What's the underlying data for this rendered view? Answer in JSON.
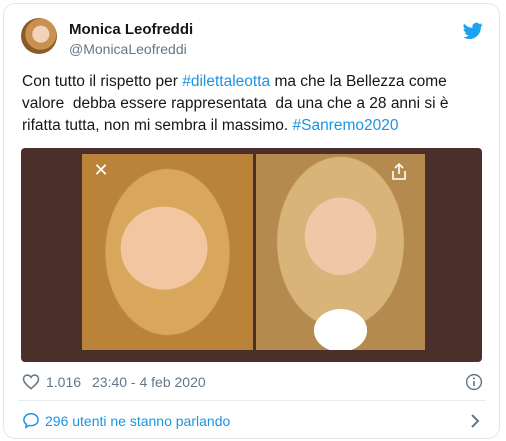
{
  "author": {
    "name": "Monica Leofreddi",
    "handle": "@MonicaLeofreddi"
  },
  "tweet": {
    "text_before": "Con tutto il rispetto per ",
    "mention_tag": "#dilettaleotta",
    "text_middle": " ma che la Bellezza come valore  debba essere rappresentata  da una che a 28 anni si è rifatta tutta, non mi sembra il massimo. ",
    "hashtag": "#Sanremo2020"
  },
  "media": {
    "close_symbol": "✕"
  },
  "meta": {
    "likes": "1.016",
    "timestamp": "23:40 - 4 feb 2020"
  },
  "conversation": {
    "label": "296 utenti ne stanno parlando"
  },
  "colors": {
    "link": "#1b95e0",
    "twitter_blue": "#1da1f2",
    "muted": "#657786"
  },
  "icons": [
    "twitter-bird-icon",
    "close-icon",
    "share-icon",
    "heart-icon",
    "info-icon",
    "speech-bubble-icon",
    "chevron-right-icon"
  ]
}
